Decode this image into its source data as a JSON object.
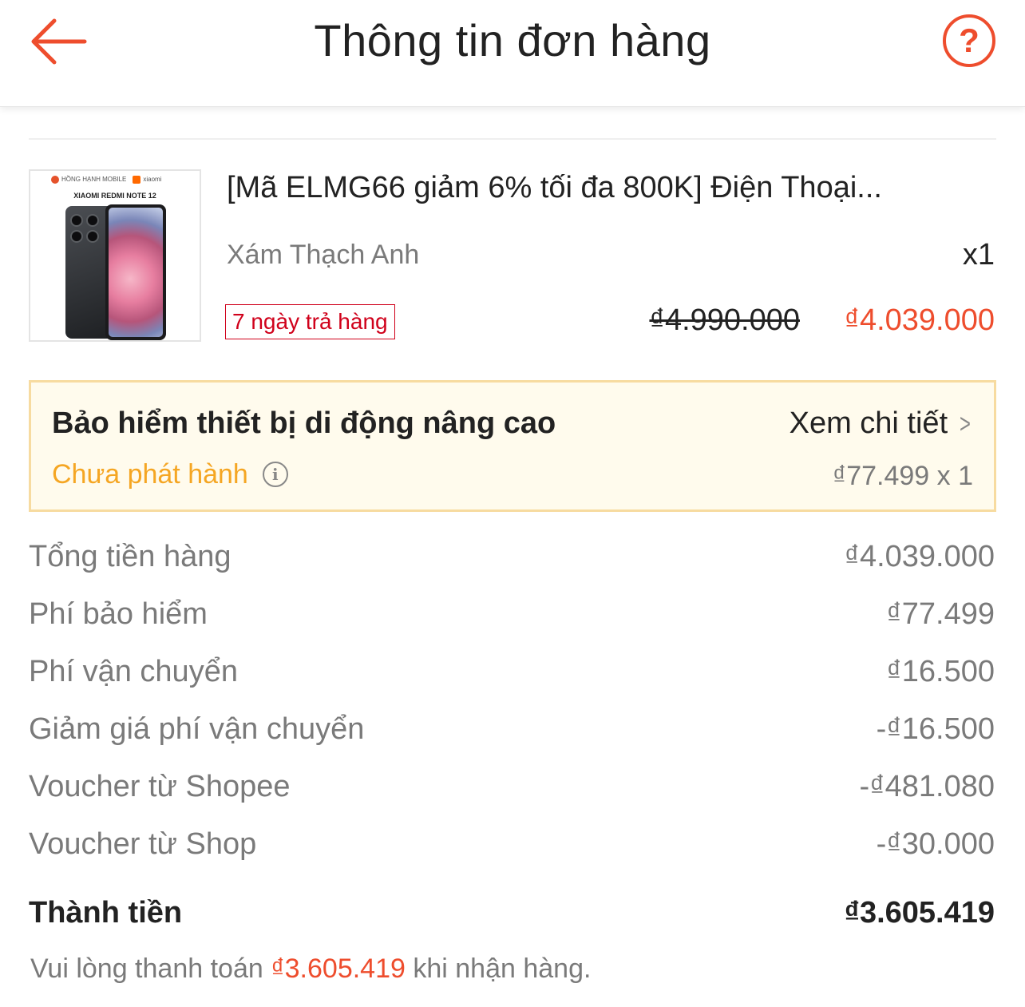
{
  "header": {
    "title": "Thông tin đơn hàng",
    "back_icon": "arrow-left-icon",
    "help_icon": "question-circle-icon",
    "help_label": "?"
  },
  "product": {
    "thumb_brand": "HỒNG HẠNH MOBILE",
    "thumb_brand2": "xiaomi",
    "thumb_model": "XIAOMI REDMI NOTE 12",
    "name": "[Mã ELMG66 giảm 6% tối đa 800K] Điện Thoại...",
    "variant": "Xám Thạch Anh",
    "quantity": "x1",
    "return_policy": "7 ngày trả hàng",
    "original_price": "₫4.990.000",
    "price": "₫4.039.000"
  },
  "insurance": {
    "title": "Bảo hiểm thiết bị di động nâng cao",
    "detail_link": "Xem chi tiết",
    "status": "Chưa phát hành",
    "price": "₫77.499 x 1"
  },
  "summary": [
    {
      "label": "Tổng tiền hàng",
      "value": "₫4.039.000"
    },
    {
      "label": "Phí bảo hiểm",
      "value": "₫77.499"
    },
    {
      "label": "Phí vận chuyển",
      "value": "₫16.500"
    },
    {
      "label": "Giảm giá phí vận chuyển",
      "value": "-₫16.500"
    },
    {
      "label": "Voucher từ Shopee",
      "value": "-₫481.080"
    },
    {
      "label": "Voucher từ Shop",
      "value": "-₫30.000"
    }
  ],
  "total": {
    "label": "Thành tiền",
    "value": "₫3.605.419"
  },
  "note": {
    "prefix": "Vui lòng thanh toán ",
    "amount": "₫3.605.419",
    "suffix": " khi nhận hàng."
  },
  "colors": {
    "accent": "#ee4d2d",
    "warning": "#f5a623",
    "badge": "#d0011b"
  }
}
